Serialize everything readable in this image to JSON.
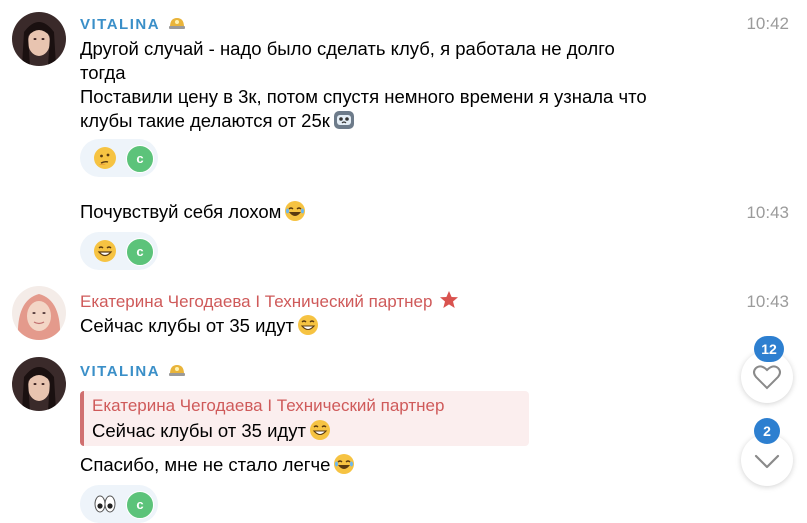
{
  "messages": [
    {
      "sender": "VITALINA",
      "time": "10:42",
      "lines": [
        "Другой случай - надо было сделать клуб, я работала не долго",
        "тогда",
        "Поставили цену в 3к, потом спустя немного времени я узнала что",
        "клубы такие делаются от 25к"
      ],
      "reaction_emoji": "thinking-face",
      "reaction_avatar_letter": "c"
    },
    {
      "time": "10:43",
      "text": "Почувствуй себя лохом",
      "reaction_emoji": "grinning-face",
      "reaction_avatar_letter": "c"
    },
    {
      "sender": "Екатерина Чегодаева I Технический партнер",
      "time": "10:43",
      "text": "Сейчас клубы от 35 идут"
    },
    {
      "sender": "VITALINA",
      "reply_to": {
        "sender": "Екатерина Чегодаева I Технический партнер",
        "text": "Сейчас клубы от 35 идут"
      },
      "text": "Спасибо, мне не стало легче",
      "reaction_emoji": "eyes",
      "reaction_avatar_letter": "c"
    }
  ],
  "floating": {
    "reactions_count": "12",
    "mentions_count": "2"
  },
  "colors": {
    "vitalina_name": "#3a8fc8",
    "ekaterina_name": "#cf5a5a",
    "badge": "#2d7fd0",
    "reaction_bg": "#eef4fa",
    "reaction_avatar": "#5cc37a"
  }
}
